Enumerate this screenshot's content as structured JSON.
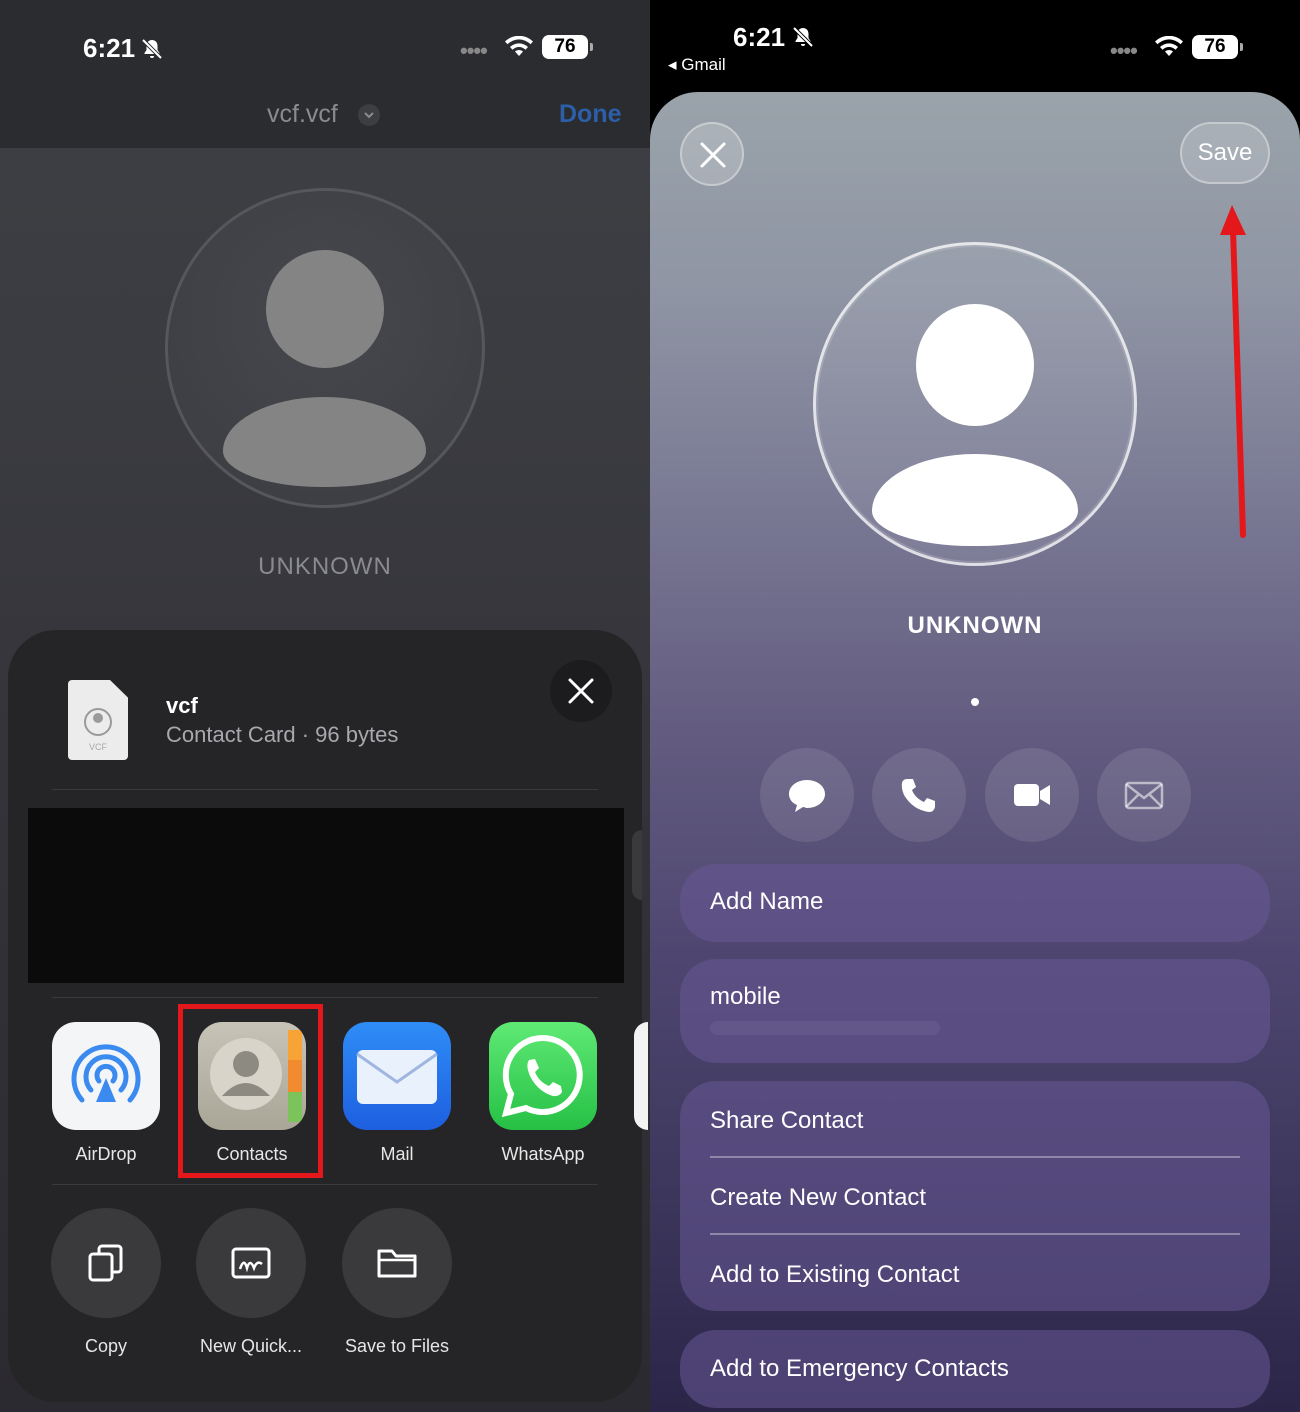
{
  "left": {
    "status": {
      "time": "6:21",
      "battery": "76"
    },
    "nav": {
      "title": "vcf.vcf",
      "done": "Done"
    },
    "contact_name": "UNKNOWN",
    "sheet": {
      "file_name": "vcf",
      "file_desc": "Contact Card · 96 bytes",
      "file_icon_text": "VCF",
      "apps": [
        {
          "label": "AirDrop",
          "icon": "airdrop-icon"
        },
        {
          "label": "Contacts",
          "icon": "contacts-icon"
        },
        {
          "label": "Mail",
          "icon": "mail-icon"
        },
        {
          "label": "WhatsApp",
          "icon": "whatsapp-icon"
        }
      ],
      "actions": [
        {
          "label": "Copy",
          "icon": "copy-icon"
        },
        {
          "label": "New Quick...",
          "icon": "quick-note-icon"
        },
        {
          "label": "Save to Files",
          "icon": "folder-icon"
        }
      ]
    }
  },
  "right": {
    "status": {
      "time": "6:21",
      "battery": "76",
      "back": "Gmail"
    },
    "save_label": "Save",
    "contact_name": "UNKNOWN",
    "quick_actions": [
      "message-icon",
      "phone-icon",
      "video-icon",
      "mail-icon"
    ],
    "fields": {
      "add_name": "Add Name",
      "mobile": "mobile",
      "share": "Share Contact",
      "create": "Create New Contact",
      "add_existing": "Add to Existing Contact",
      "emergency": "Add to Emergency Contacts"
    }
  },
  "colors": {
    "highlight": "#e4181b",
    "done_blue": "#2c5fa8"
  }
}
